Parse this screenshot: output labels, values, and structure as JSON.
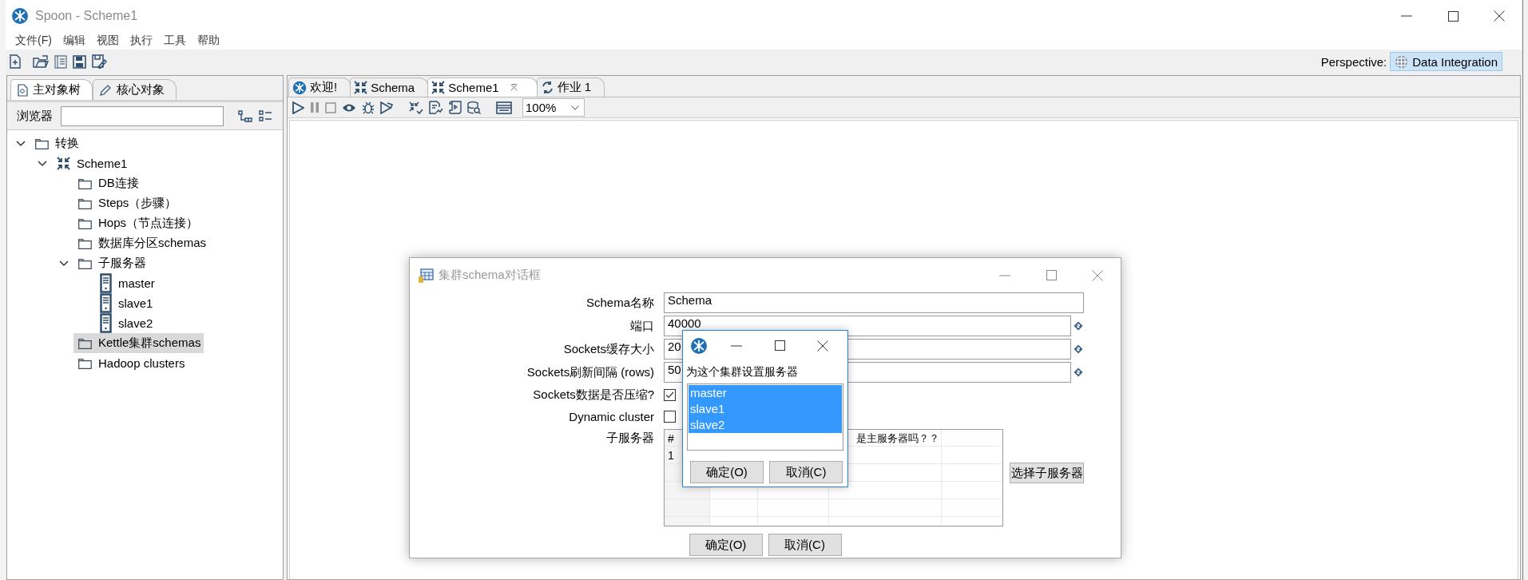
{
  "window": {
    "title": "Spoon - Scheme1"
  },
  "menu": [
    "文件(F)",
    "编辑",
    "视图",
    "执行",
    "工具",
    "帮助"
  ],
  "perspective": {
    "label": "Perspective:",
    "value": "Data Integration"
  },
  "left_panel": {
    "tabs": [
      {
        "label": "主对象树",
        "selected": true
      },
      {
        "label": "核心对象",
        "selected": false
      }
    ],
    "search": {
      "label": "浏览器"
    },
    "tree": [
      {
        "label": "转换",
        "kind": "folder",
        "expanded": true,
        "selected": false,
        "children": [
          {
            "label": "Scheme1",
            "kind": "transformation",
            "expanded": true,
            "selected": false,
            "children": [
              {
                "label": "DB连接",
                "kind": "folder",
                "selected": false
              },
              {
                "label": "Steps（步骤）",
                "kind": "folder",
                "selected": false
              },
              {
                "label": "Hops（节点连接）",
                "kind": "folder",
                "selected": false
              },
              {
                "label": "数据库分区schemas",
                "kind": "folder",
                "selected": false
              },
              {
                "label": "子服务器",
                "kind": "folder",
                "expanded": true,
                "selected": false,
                "children": [
                  {
                    "label": "master",
                    "kind": "server",
                    "selected": false
                  },
                  {
                    "label": "slave1",
                    "kind": "server",
                    "selected": false
                  },
                  {
                    "label": "slave2",
                    "kind": "server",
                    "selected": false
                  }
                ]
              },
              {
                "label": "Kettle集群schemas",
                "kind": "folder",
                "selected": true
              },
              {
                "label": "Hadoop clusters",
                "kind": "folder",
                "selected": false
              }
            ]
          }
        ]
      }
    ]
  },
  "editor": {
    "tabs": [
      {
        "label": "欢迎!",
        "kind": "welcome",
        "selected": false
      },
      {
        "label": "Schema",
        "kind": "transformation",
        "selected": false
      },
      {
        "label": "Scheme1",
        "kind": "transformation",
        "selected": true,
        "closable": true
      },
      {
        "label": "作业 1",
        "kind": "job",
        "selected": false
      }
    ],
    "zoom": "100%"
  },
  "dialog": {
    "title": "集群schema对话框",
    "fields": [
      {
        "label": "Schema名称",
        "kind": "text",
        "value": "Schema"
      },
      {
        "label": "端口",
        "kind": "variable",
        "value": "40000"
      },
      {
        "label": "Sockets缓存大小",
        "kind": "variable",
        "value": "20"
      },
      {
        "label": "Sockets刷新间隔 (rows)",
        "kind": "variable",
        "value": "50"
      },
      {
        "label": "Sockets数据是否压缩?",
        "kind": "checkbox",
        "checked": true
      },
      {
        "label": "Dynamic cluster",
        "kind": "checkbox",
        "checked": false
      }
    ],
    "servers": {
      "label": "子服务器",
      "columns": [
        "#",
        "是主服务器吗？？"
      ],
      "rows": [
        [
          "1"
        ]
      ]
    },
    "select_button": "选择子服务器",
    "buttons": [
      "确定(O)",
      "取消(C)"
    ]
  },
  "popup": {
    "label": "为这个集群设置服务器",
    "options": [
      {
        "label": "master",
        "selected": true
      },
      {
        "label": "slave1",
        "selected": true
      },
      {
        "label": "slave2",
        "selected": true
      }
    ],
    "buttons": [
      "确定(O)",
      "取消(C)"
    ]
  }
}
